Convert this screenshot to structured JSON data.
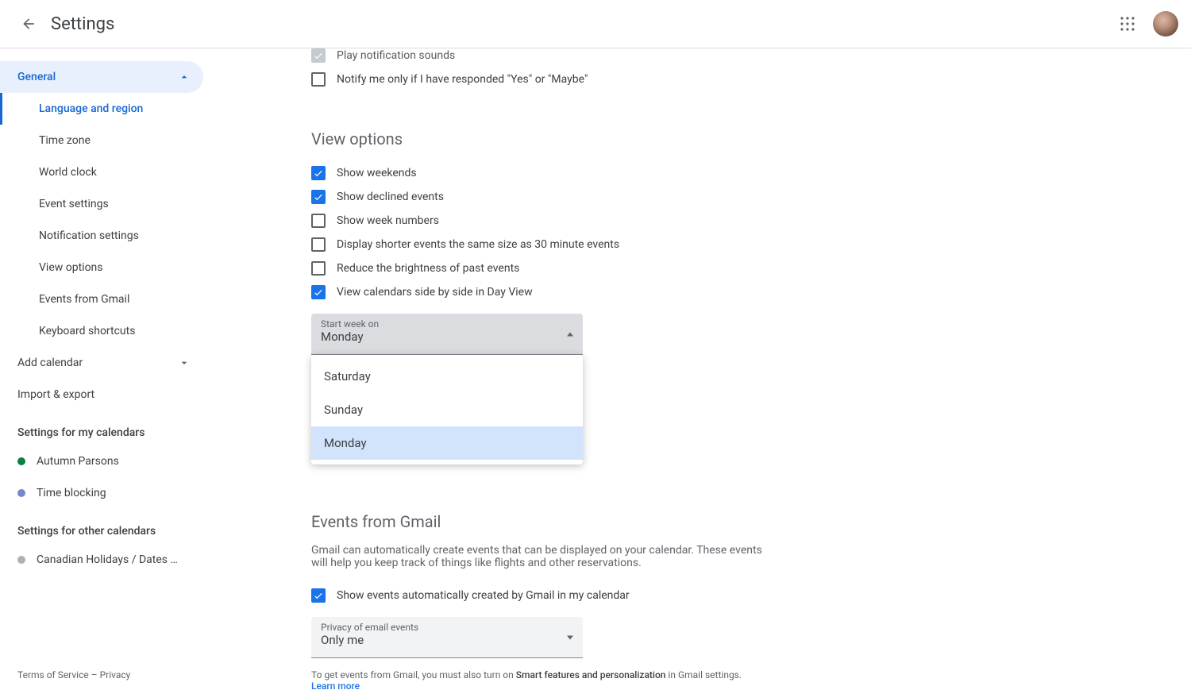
{
  "header": {
    "title": "Settings"
  },
  "sidebar": {
    "general": {
      "label": "General",
      "items": [
        "Language and region",
        "Time zone",
        "World clock",
        "Event settings",
        "Notification settings",
        "View options",
        "Events from Gmail",
        "Keyboard shortcuts"
      ]
    },
    "add_calendar": "Add calendar",
    "import_export": "Import & export",
    "my_calendars_label": "Settings for my calendars",
    "my_calendars": [
      {
        "name": "Autumn Parsons",
        "color": "#0b8043"
      },
      {
        "name": "Time blocking",
        "color": "#7986cb"
      }
    ],
    "other_calendars_label": "Settings for other calendars",
    "other_calendars": [
      {
        "name": "Canadian Holidays / Dates t…",
        "color": "#b0b0b0"
      }
    ]
  },
  "notifications": {
    "play_sounds": "Play notification sounds",
    "notify_yes_maybe": "Notify me only if I have responded \"Yes\" or \"Maybe\""
  },
  "view_options": {
    "title": "View options",
    "checks": {
      "show_weekends": "Show weekends",
      "show_declined": "Show declined events",
      "show_week_numbers": "Show week numbers",
      "shorter_events": "Display shorter events the same size as 30 minute events",
      "reduce_brightness": "Reduce the brightness of past events",
      "side_by_side": "View calendars side by side in Day View"
    },
    "start_week_label": "Start week on",
    "start_week_value": "Monday",
    "start_week_options": [
      "Saturday",
      "Sunday",
      "Monday"
    ]
  },
  "gmail": {
    "title": "Events from Gmail",
    "desc": "Gmail can automatically create events that can be displayed on your calendar. These events will help you keep track of things like flights and other reservations.",
    "show_events": "Show events automatically created by Gmail in my calendar",
    "privacy_label": "Privacy of email events",
    "privacy_value": "Only me",
    "hint_pre": "To get events from Gmail, you must also turn on ",
    "hint_strong": "Smart features and personalization",
    "hint_post": " in Gmail settings.",
    "learn_more": "Learn more"
  },
  "footer": {
    "terms": "Terms of Service",
    "sep": " – ",
    "privacy": "Privacy"
  }
}
